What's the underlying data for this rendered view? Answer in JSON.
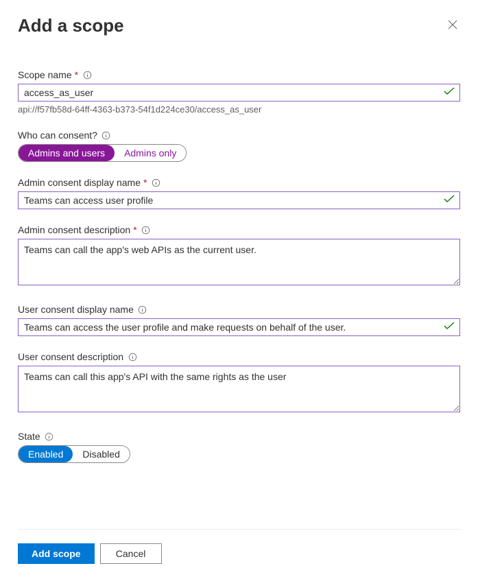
{
  "title": "Add a scope",
  "scope_name": {
    "label": "Scope name",
    "value": "access_as_user",
    "helper": "api://f57fb58d-64ff-4363-b373-54f1d224ce30/access_as_user"
  },
  "who_can_consent": {
    "label": "Who can consent?",
    "option_admins_users": "Admins and users",
    "option_admins_only": "Admins only"
  },
  "admin_consent_display": {
    "label": "Admin consent display name",
    "value": "Teams can access user profile"
  },
  "admin_consent_description": {
    "label": "Admin consent description",
    "value": "Teams can call the app's web APIs as the current user."
  },
  "user_consent_display": {
    "label": "User consent display name",
    "value": "Teams can access the user profile and make requests on behalf of the user."
  },
  "user_consent_description": {
    "label": "User consent description",
    "value": "Teams can call this app's API with the same rights as the user"
  },
  "state": {
    "label": "State",
    "option_enabled": "Enabled",
    "option_disabled": "Disabled"
  },
  "footer": {
    "add_scope": "Add scope",
    "cancel": "Cancel"
  }
}
